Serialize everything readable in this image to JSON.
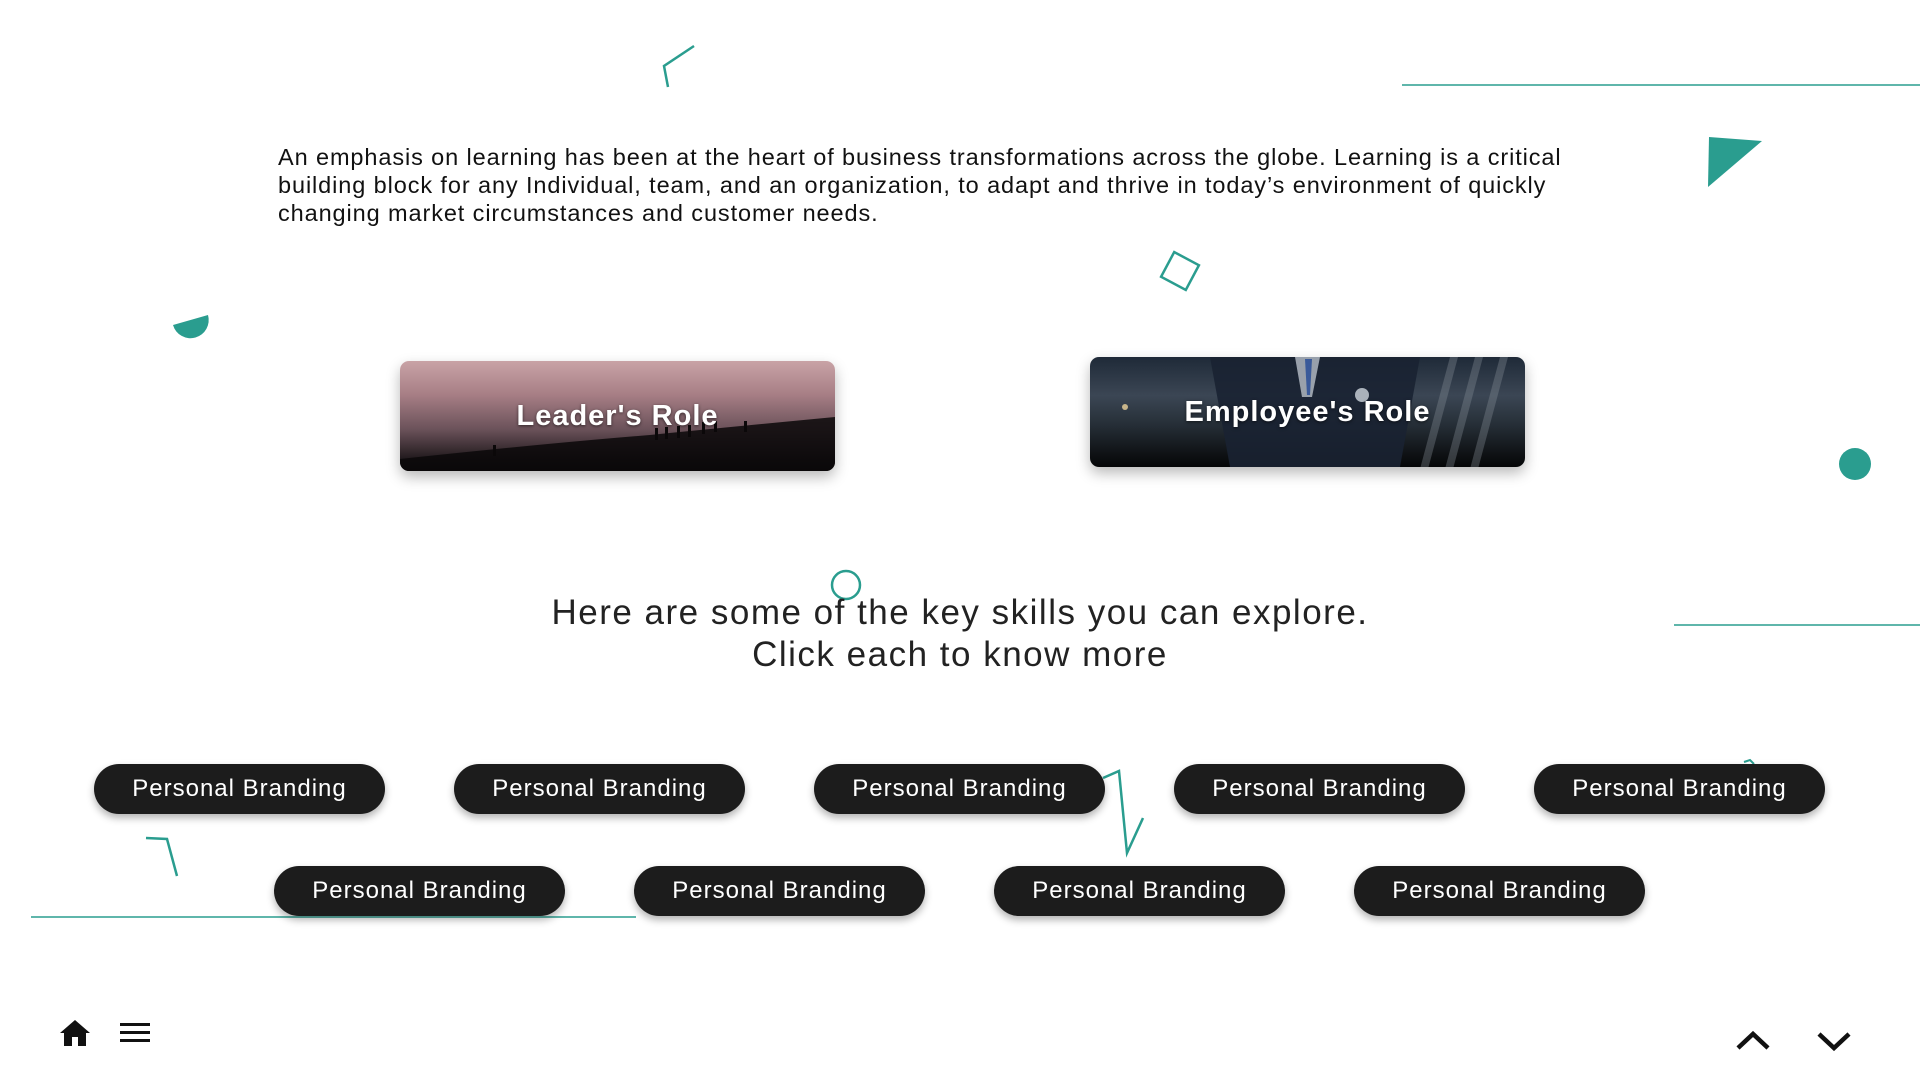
{
  "intro": {
    "text": "An emphasis on learning has been at the heart of business transformations across the globe. Learning is a critical building block for any Individual, team, and an organization, to adapt and thrive in today’s environment of quickly changing market circumstances and customer needs."
  },
  "roles": [
    {
      "label": "Leader's Role"
    },
    {
      "label": "Employee's Role"
    }
  ],
  "skills_heading": {
    "line1": "Here are some of the key skills you can explore.",
    "line2": "Click each to know more"
  },
  "skills": [
    {
      "label": "Personal Branding"
    },
    {
      "label": "Personal Branding"
    },
    {
      "label": "Personal Branding"
    },
    {
      "label": "Personal Branding"
    },
    {
      "label": "Personal Branding"
    },
    {
      "label": "Personal Branding"
    },
    {
      "label": "Personal Branding"
    },
    {
      "label": "Personal Branding"
    },
    {
      "label": "Personal Branding"
    }
  ],
  "footer": {
    "home_icon": "home-icon",
    "menu_icon": "hamburger-menu-icon",
    "prev_icon": "chevron-up-icon",
    "next_icon": "chevron-down-icon"
  },
  "colors": {
    "accent": "#2a9d8f",
    "pill_bg": "#1c1c1c",
    "text": "#111111"
  }
}
